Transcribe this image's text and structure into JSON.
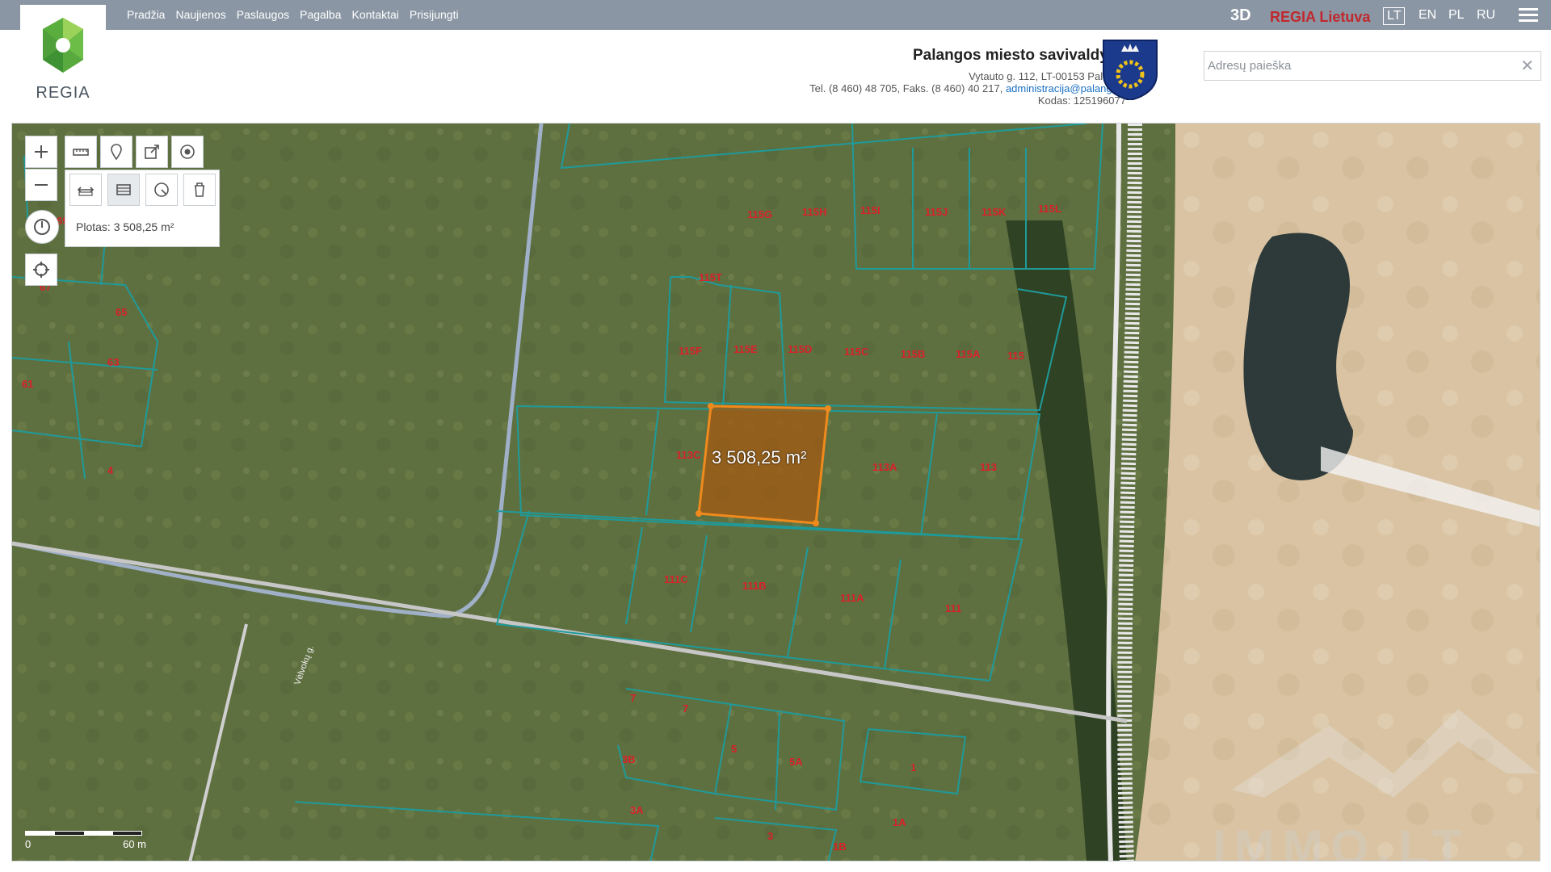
{
  "nav": {
    "items": [
      "Pradžia",
      "Naujienos",
      "Paslaugos",
      "Pagalba",
      "Kontaktai",
      "Prisijungti"
    ]
  },
  "brand": {
    "logo_text": "REGIA"
  },
  "header_right": {
    "btn_3d": "3D",
    "regia_lietuva": "REGIA Lietuva",
    "languages": [
      "LT",
      "EN",
      "PL",
      "RU"
    ],
    "active_language": "LT"
  },
  "municipality": {
    "name": "Palangos miesto savivaldybė",
    "address": "Vytauto g. 112, LT-00153 Palanga",
    "phone": "Tel. (8 460) 48 705, Faks. (8 460) 40 217, ",
    "email": "administracija@palanga.lt",
    "code": "Kodas: 125196077"
  },
  "search": {
    "placeholder": "Adresų paieška",
    "value": ""
  },
  "map": {
    "area_text": "Plotas: 3 508,25 m²",
    "measure_label": "3 508,25 m²",
    "scale": {
      "start": "0",
      "end": "60 m"
    },
    "street_label": "Vėlvokų g.",
    "parcels": [
      "115G",
      "115H",
      "115I",
      "115J",
      "115K",
      "115L",
      "115T",
      "115F",
      "115E",
      "115D",
      "115C",
      "115B",
      "115A",
      "115",
      "113C",
      "113A",
      "113",
      "111C",
      "111B",
      "111A",
      "111",
      "7",
      "7",
      "5",
      "5A",
      "3B",
      "3A",
      "3",
      "1",
      "1A",
      "1B",
      "65",
      "63",
      "61",
      "4",
      "69",
      "67"
    ],
    "watermark": "IMMO.LT"
  },
  "colors": {
    "topbar": "#8a96a3",
    "parcel_line": "#1f9a9a",
    "highlight": "#f08a1c",
    "label": "#d8202a"
  }
}
